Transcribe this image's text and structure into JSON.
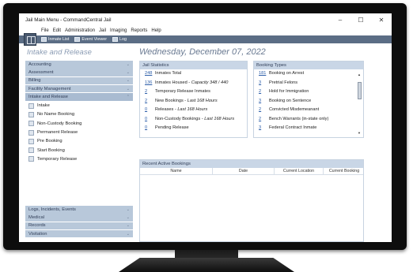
{
  "window": {
    "title": "Jail Main Menu - CommandCentral Jail",
    "controls": [
      "–",
      "☐",
      "✕"
    ]
  },
  "menubar": [
    "File",
    "Edit",
    "Administration",
    "Jail",
    "Imaging",
    "Reports",
    "Help"
  ],
  "toolbar": [
    {
      "label": "Inmate List",
      "icon": "inmate-list-icon"
    },
    {
      "label": "Event Viewer",
      "icon": "event-viewer-icon"
    },
    {
      "label": "Log",
      "icon": "log-icon"
    }
  ],
  "sidebar": {
    "title": "Intake and Release",
    "top_sections": [
      "Accounting",
      "Assessment",
      "Billing",
      "Facility Management",
      "Intake and Release"
    ],
    "open_items": [
      "Intake",
      "No Name Booking",
      "Non-Custody Booking",
      "Permanent Release",
      "Pre Booking",
      "Start Booking",
      "Temporary Release"
    ],
    "bottom_sections": [
      "Logs, Incidents, Events",
      "Medical",
      "Records",
      "Visitation"
    ]
  },
  "main": {
    "date": "Wednesday, December 07, 2022",
    "jail_statistics": {
      "title": "Jail Statistics",
      "rows": [
        {
          "num": "248",
          "text": "Inmates Total",
          "note": ""
        },
        {
          "num": "136",
          "text": "Inmates Housed - ",
          "note": "Capacity 348 / 440"
        },
        {
          "num": "2",
          "text": "Temporary Release Inmates",
          "note": ""
        },
        {
          "num": "2",
          "text": "New Bookings - ",
          "note": "Last 168 Hours"
        },
        {
          "num": "0",
          "text": "Releases - ",
          "note": "Last 168 Hours"
        },
        {
          "num": "0",
          "text": "Non-Custody Bookings - ",
          "note": "Last 168 Hours"
        },
        {
          "num": "0",
          "text": "Pending Release",
          "note": ""
        }
      ]
    },
    "booking_types": {
      "title": "Booking Types",
      "rows": [
        {
          "num": "181",
          "text": "Booking on Arrest"
        },
        {
          "num": "3",
          "text": "Pretrial Felons"
        },
        {
          "num": "2",
          "text": "Hold for Immigration"
        },
        {
          "num": "3",
          "text": "Booking on Sentence"
        },
        {
          "num": "2",
          "text": "Convicted Misdemeanant"
        },
        {
          "num": "2",
          "text": "Bench Warrants (in-state only)"
        },
        {
          "num": "3",
          "text": "Federal Contract Inmate"
        }
      ]
    },
    "recent_bookings": {
      "title": "Recent Active Bookings",
      "columns": [
        "Name",
        "Date",
        "Current Location",
        "Current Booking"
      ]
    }
  }
}
